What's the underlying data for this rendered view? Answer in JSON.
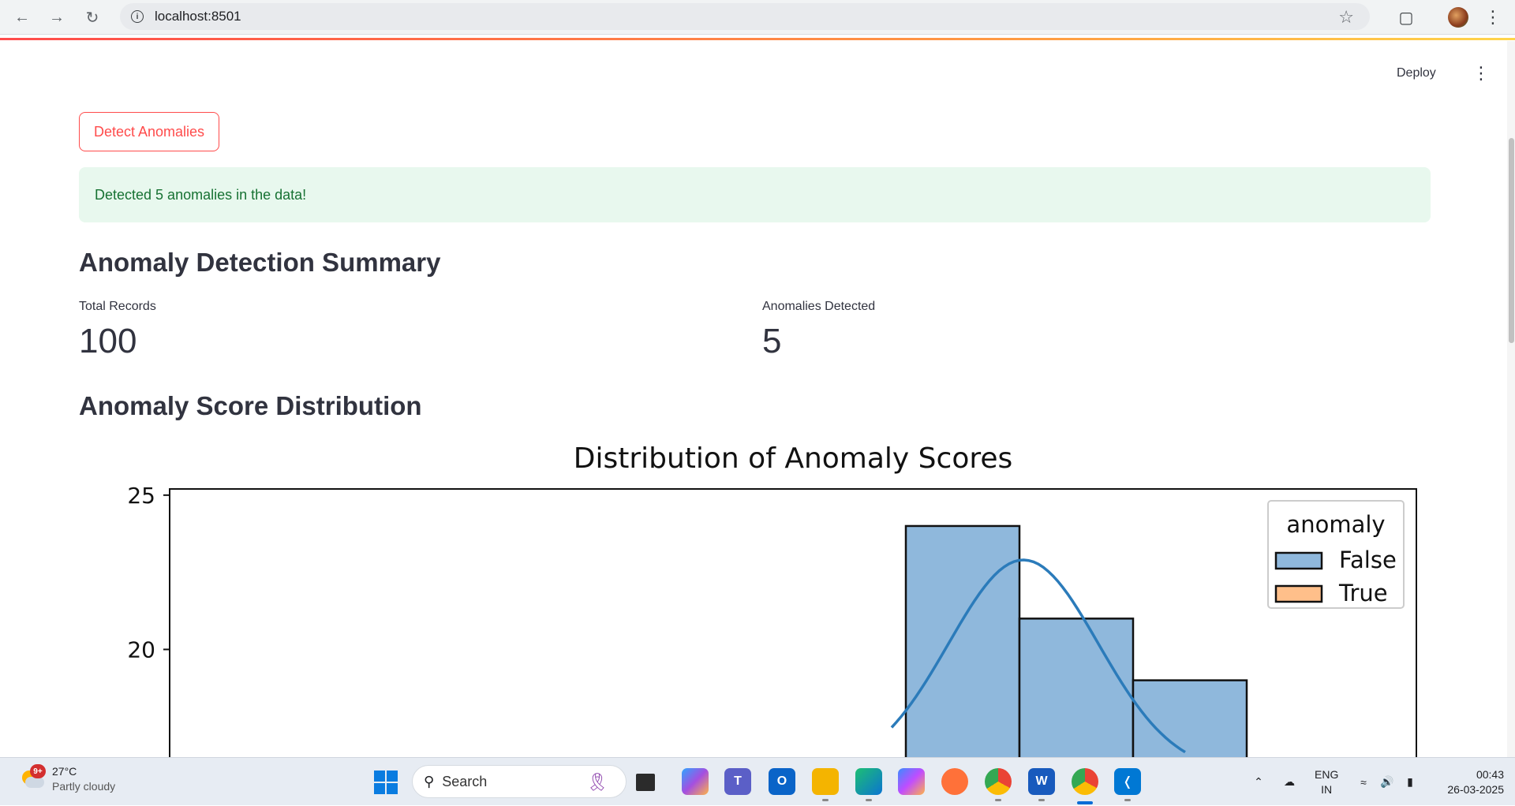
{
  "browser": {
    "url": "localhost:8501"
  },
  "header": {
    "deploy_label": "Deploy"
  },
  "main": {
    "detect_button": "Detect Anomalies",
    "success_message": "Detected 5 anomalies in the data!",
    "summary_heading": "Anomaly Detection Summary",
    "metrics": [
      {
        "label": "Total Records",
        "value": "100"
      },
      {
        "label": "Anomalies Detected",
        "value": "5"
      }
    ],
    "distribution_heading": "Anomaly Score Distribution"
  },
  "chart_data": {
    "type": "bar",
    "title": "Distribution of Anomaly Scores",
    "y_ticks_visible": [
      "25",
      "20"
    ],
    "legend": {
      "title": "anomaly",
      "placement": "top-right",
      "entries": [
        {
          "label": "False",
          "color": "#8fb8dc"
        },
        {
          "label": "True",
          "color": "#ffbf8a"
        }
      ]
    },
    "series": [
      {
        "name": "False",
        "bins": [
          {
            "bin_index": 0,
            "count": 24
          },
          {
            "bin_index": 1,
            "count": 21
          },
          {
            "bin_index": 2,
            "count": 19
          }
        ]
      }
    ],
    "kde_line": true,
    "ylim_visible": [
      16,
      25.2
    ]
  },
  "taskbar": {
    "weather_temp": "27°C",
    "weather_desc": "Partly cloudy",
    "weather_badge": "9+",
    "search_label": "Search",
    "lang_top": "ENG",
    "lang_bottom": "IN",
    "time": "00:43",
    "date": "26-03-2025"
  },
  "colors": {
    "accent": "#ff4b4b",
    "success_bg": "#e8f8ee",
    "success_text": "#177233",
    "bar_false": "#8fb8dc",
    "bar_edge": "#111111",
    "kde": "#2b7bba"
  }
}
